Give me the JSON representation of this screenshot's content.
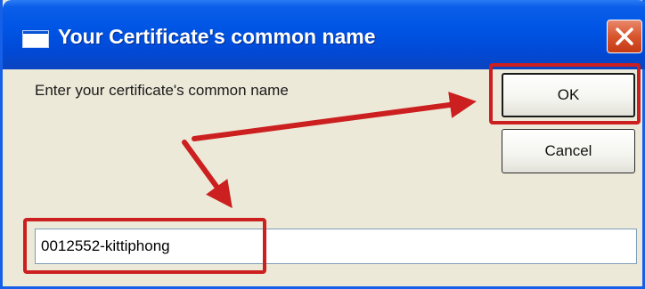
{
  "dialog": {
    "title": "Your Certificate's common name",
    "prompt": "Enter your certificate's common name",
    "ok_label": "OK",
    "cancel_label": "Cancel",
    "input_value": "0012552-kittiphong"
  },
  "annotations": {
    "highlight_color": "#cc1f1f"
  },
  "theme": {
    "titlebar_color": "#0055e5",
    "window_bg": "#ece9d8",
    "close_button_color": "#d8562e"
  },
  "icons": {
    "title_icon": "window-icon",
    "close_icon": "close-x-icon"
  }
}
